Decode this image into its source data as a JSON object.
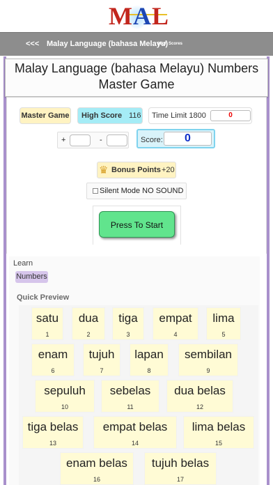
{
  "logo": {
    "m": "M",
    "a": "A",
    "l": "L"
  },
  "nav": {
    "back_label": "<<<",
    "title": "Malay Language (bahasa Melayu)",
    "high_scores_link": "High Scores"
  },
  "page": {
    "title": "Malay Language (bahasa Melayu) Numbers Master Game"
  },
  "game": {
    "mode_label": "Master Game",
    "high_score_label": "High Score",
    "high_score_value": "116",
    "time_limit_label": "Time Limit 1800",
    "time_remaining": "0",
    "plus_sign": "+",
    "minus_sign": "-",
    "score_label": "Score:",
    "score_value": "0",
    "bonus_label": "Bonus Points",
    "bonus_value": "+20",
    "silent_mode_label": "Silent Mode NO SOUND",
    "silent_mode_checked": false,
    "start_label": "Press To Start"
  },
  "learn": {
    "label": "Learn",
    "category": "Numbers",
    "quick_preview_label": "Quick Preview",
    "cards": [
      {
        "word": "satu",
        "num": "1"
      },
      {
        "word": "dua",
        "num": "2"
      },
      {
        "word": "tiga",
        "num": "3"
      },
      {
        "word": "empat",
        "num": "4"
      },
      {
        "word": "lima",
        "num": "5"
      },
      {
        "word": "enam",
        "num": "6"
      },
      {
        "word": "tujuh",
        "num": "7"
      },
      {
        "word": "lapan",
        "num": "8"
      },
      {
        "word": "sembilan",
        "num": "9"
      },
      {
        "word": "sepuluh",
        "num": "10"
      },
      {
        "word": "sebelas",
        "num": "11"
      },
      {
        "word": "dua belas",
        "num": "12"
      },
      {
        "word": "tiga belas",
        "num": "13"
      },
      {
        "word": "empat belas",
        "num": "14"
      },
      {
        "word": "lima belas",
        "num": "15"
      },
      {
        "word": "enam belas",
        "num": "16"
      },
      {
        "word": "tujuh belas",
        "num": "17"
      }
    ]
  },
  "colors": {
    "frame": "#a991cc",
    "nav_bar": "#8d8d8d",
    "start_button": "#61e48d",
    "card_bg": "#fffbd5",
    "score_value": "#1030c8",
    "timer_value": "#ee0000"
  },
  "icons": {
    "bonus": "crown-icon",
    "silent": "checkbox"
  }
}
